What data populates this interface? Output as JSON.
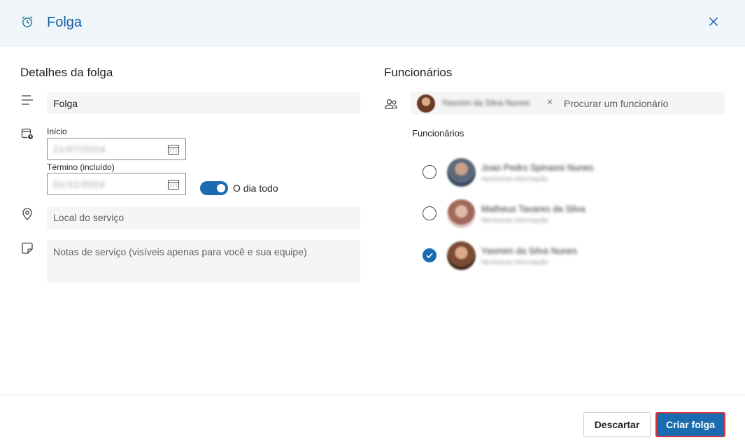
{
  "header": {
    "title": "Folga",
    "icon": "alarm-clock-icon",
    "close_icon": "close-icon"
  },
  "details": {
    "section_title": "Detalhes da folga",
    "title_value": "Folga",
    "start_label": "Início",
    "start_date": "21/07/2024",
    "end_label": "Término (incluído)",
    "end_date": "01/11/2024",
    "all_day_label": "O dia todo",
    "all_day_on": true,
    "location_placeholder": "Local do serviço",
    "notes_placeholder": "Notas de serviço (visíveis apenas para você e sua equipe)"
  },
  "employees": {
    "section_title": "Funcionários",
    "selected_chip": "Yasmim da Silva Nunes",
    "search_placeholder": "Procurar um funcionário",
    "list_label": "Funcionários",
    "items": [
      {
        "name": "Joao Pedro Spinassi Nunes",
        "subtitle": "Nenhuma informação",
        "checked": false
      },
      {
        "name": "Matheus Tavares da Silva",
        "subtitle": "Nenhuma informação",
        "checked": false
      },
      {
        "name": "Yasmim da Silva Nunes",
        "subtitle": "Nenhuma informação",
        "checked": true
      }
    ]
  },
  "footer": {
    "discard_label": "Descartar",
    "create_label": "Criar folga"
  },
  "colors": {
    "accent": "#1a6bb0",
    "header_bg": "#f0f5fa",
    "title": "#115ea3",
    "highlight_border": "#d6333a"
  }
}
